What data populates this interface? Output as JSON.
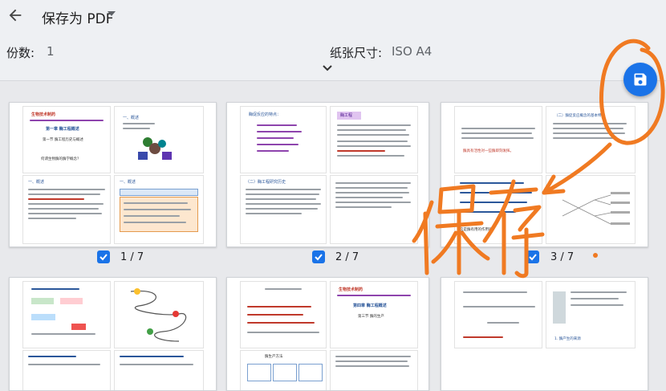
{
  "header": {
    "title": "保存为 PDF",
    "back_icon": "arrow-left-icon",
    "title_dropdown_icon": "caret-down-icon"
  },
  "options": {
    "copies_label": "份数:",
    "copies_value": "1",
    "paper_label": "纸张尺寸:",
    "paper_value": "ISO A4",
    "expand_icon": "chevron-down-icon"
  },
  "save_button": {
    "icon": "save-icon",
    "color": "#1a73e8"
  },
  "pages": [
    {
      "count": "1 / 7",
      "checked": true
    },
    {
      "count": "2 / 7",
      "checked": true
    },
    {
      "count": "3 / 7",
      "checked": true
    }
  ],
  "thumb_text": {
    "p1_title": "生物技术制药",
    "p1_chapter": "第一章 酶工程概述",
    "p1_section": "第一节 酶工程历史与概述",
    "p1_q": "何谓生物酶的酶学概念？",
    "p1_s2": "一、概述",
    "p1_s3": "一、概述",
    "p1_s4": "一、概述",
    "p2_title": "酶促反应的特点：",
    "p2_box": "酶工程",
    "p2_s3": "（二）酶工程研究历史",
    "p3_s1": "（二）酶促反应概念的基本特性",
    "p3_red": "酶具有活性对一些酶即刻发挥。",
    "p3_q": "这是酶有用的作用吗？",
    "p4_title": "生物技术制药",
    "p4_chapter": "第四章 酶工程概述",
    "p4_section": "第三节 酶的生产",
    "p6_title": "酶生产方法",
    "p6_s2": "1. 酶产生的来源",
    "annotation": "保存"
  },
  "colors": {
    "annotation": "#f07a22",
    "accent": "#1a73e8"
  }
}
